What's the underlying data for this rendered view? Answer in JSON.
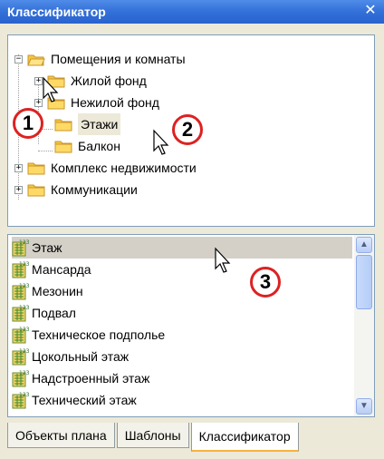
{
  "window": {
    "title": "Классификатор",
    "close_glyph": "✕"
  },
  "tree": {
    "items": [
      {
        "label": "Помещения и комнаты",
        "expander": "−",
        "icon": "folder-open-icon"
      },
      {
        "label": "Жилой фонд",
        "expander": "+",
        "icon": "folder-icon"
      },
      {
        "label": "Нежилой фонд",
        "expander": "+",
        "icon": "folder-icon"
      },
      {
        "label": "Этажи",
        "expander": "",
        "icon": "folder-icon"
      },
      {
        "label": "Балкон",
        "expander": "",
        "icon": "folder-icon"
      },
      {
        "label": "Комплекс недвижимости",
        "expander": "+",
        "icon": "folder-icon"
      },
      {
        "label": "Коммуникации",
        "expander": "+",
        "icon": "folder-icon"
      }
    ]
  },
  "list": {
    "items": [
      {
        "label": "Этаж"
      },
      {
        "label": "Мансарда"
      },
      {
        "label": "Мезонин"
      },
      {
        "label": "Подвал"
      },
      {
        "label": "Техническое подполье"
      },
      {
        "label": "Цокольный этаж"
      },
      {
        "label": "Надстроенный этаж"
      },
      {
        "label": "Технический этаж"
      }
    ],
    "selected_index": 0,
    "icon": "classifier-item-123-icon"
  },
  "scrollbar": {
    "up": "▲",
    "down": "▼"
  },
  "tabs": [
    {
      "label": "Объекты плана",
      "active": false
    },
    {
      "label": "Шаблоны",
      "active": false
    },
    {
      "label": "Классификатор",
      "active": true
    }
  ],
  "callouts": [
    "1",
    "2",
    "3"
  ],
  "colors": {
    "accent_title": "#3370d8",
    "callout_ring": "#d22222",
    "folder": "#f5c542"
  }
}
